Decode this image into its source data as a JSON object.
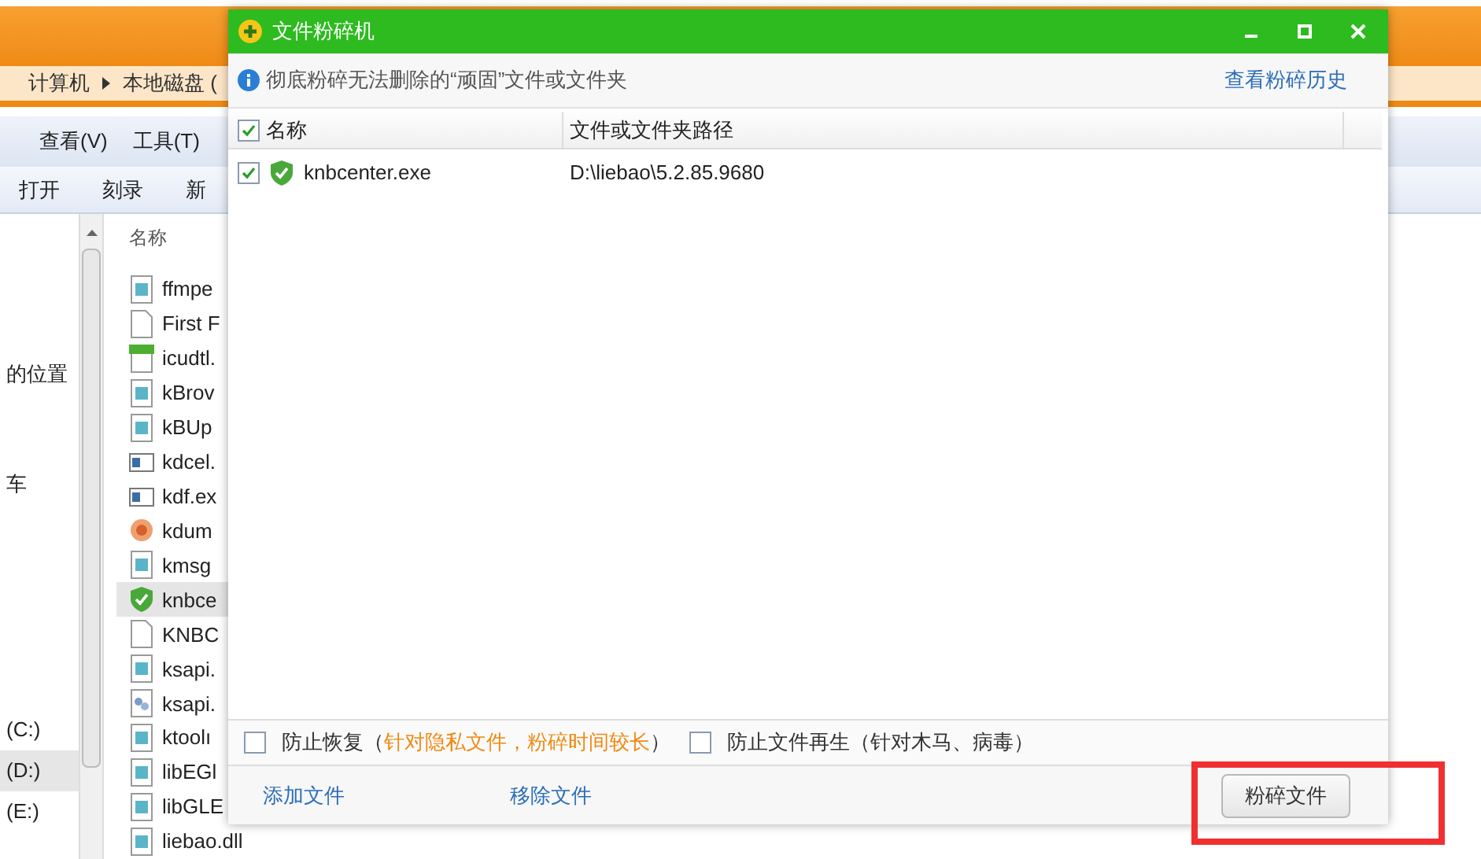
{
  "explorer": {
    "breadcrumb": [
      "计算机",
      "本地磁盘 ("
    ],
    "menu": [
      {
        "label": "查看(V)"
      },
      {
        "label": "工具(T)"
      }
    ],
    "toolbar": [
      {
        "label": "打开"
      },
      {
        "label": "刻录"
      },
      {
        "label": "新"
      }
    ],
    "nav": [
      {
        "label": "的位置",
        "selected": false
      },
      {
        "label": "车",
        "selected": false
      },
      {
        "label": "(C:)",
        "selected": false
      },
      {
        "label": "(D:)",
        "selected": true
      },
      {
        "label": "(E:)",
        "selected": false
      }
    ],
    "column_header": "名称",
    "files": [
      {
        "name": "ffmpe",
        "kind": "doc",
        "selected": false
      },
      {
        "name": "First F",
        "kind": "blank",
        "selected": false
      },
      {
        "name": "icudtl.",
        "kind": "dat",
        "selected": false
      },
      {
        "name": "kBrov",
        "kind": "doc",
        "selected": false
      },
      {
        "name": "kBUp",
        "kind": "doc",
        "selected": false
      },
      {
        "name": "kdcel.",
        "kind": "exe",
        "selected": false
      },
      {
        "name": "kdf.ex",
        "kind": "exe",
        "selected": false
      },
      {
        "name": "kdum",
        "kind": "round",
        "selected": false
      },
      {
        "name": "kmsg",
        "kind": "doc",
        "selected": false
      },
      {
        "name": "knbce",
        "kind": "shield",
        "selected": true
      },
      {
        "name": "KNBC",
        "kind": "blank",
        "selected": false
      },
      {
        "name": "ksapi.",
        "kind": "doc",
        "selected": false
      },
      {
        "name": "ksapi.",
        "kind": "link",
        "selected": false
      },
      {
        "name": "ktoolı",
        "kind": "doc",
        "selected": false
      },
      {
        "name": "libEGl",
        "kind": "doc",
        "selected": false
      },
      {
        "name": "libGLE",
        "kind": "doc",
        "selected": false
      },
      {
        "name": "liebao.dll",
        "kind": "doc",
        "selected": false
      }
    ]
  },
  "dialog": {
    "title": "文件粉碎机",
    "info": "彻底粉碎无法删除的“顽固”文件或文件夹",
    "history_link": "查看粉碎历史",
    "table": {
      "all_checked": true,
      "columns": [
        "名称",
        "文件或文件夹路径"
      ],
      "rows": [
        {
          "checked": true,
          "name": "knbcenter.exe",
          "path": "D:\\liebao\\5.2.85.9680"
        }
      ]
    },
    "options": [
      {
        "checked": false,
        "prefix": "防止恢复（",
        "note": "针对隐私文件，粉碎时间较长",
        "suffix": "）"
      },
      {
        "checked": false,
        "prefix": "防止文件再生（针对木马、病毒）"
      }
    ],
    "add_link": "添加文件",
    "remove_link": "移除文件",
    "shred_button": "粉碎文件"
  }
}
